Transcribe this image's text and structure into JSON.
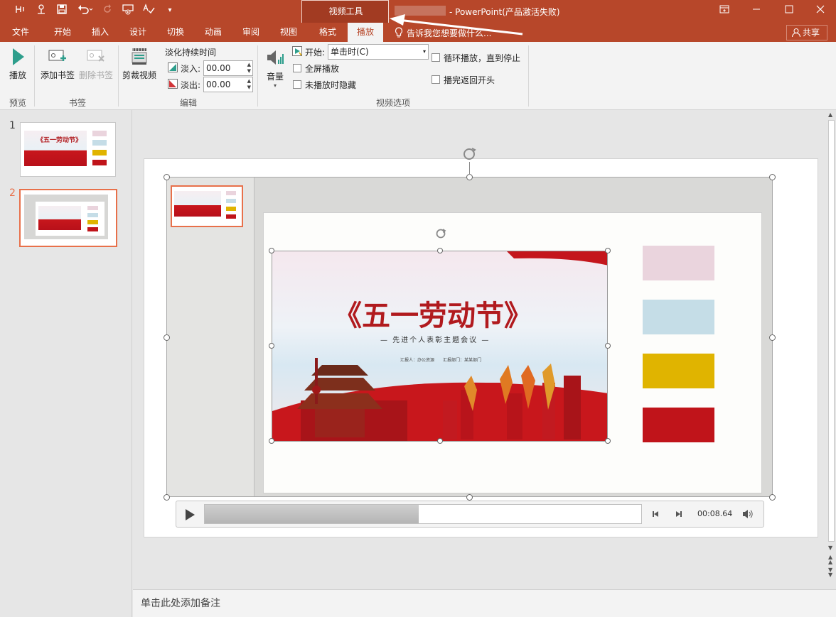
{
  "app": {
    "document_title": "- PowerPoint(产品激活失败)",
    "context_group": "视频工具",
    "share_label": "共享",
    "tell_me": "告诉我您想要做什么..."
  },
  "tabs": [
    "文件",
    "开始",
    "插入",
    "设计",
    "切换",
    "动画",
    "审阅",
    "视图"
  ],
  "context_tabs": [
    "格式",
    "播放"
  ],
  "ribbon": {
    "preview": {
      "play_label": "播放",
      "group": "预览"
    },
    "bookmarks": {
      "add_label": "添加书签",
      "delete_label": "删除书签",
      "group": "书签"
    },
    "editing": {
      "trim_label": "剪裁视频",
      "fade_title": "淡化持续时间",
      "fade_in_label": "淡入:",
      "fade_in_value": "00.00",
      "fade_out_label": "淡出:",
      "fade_out_value": "00.00",
      "group": "编辑"
    },
    "video_options": {
      "volume_label": "音量",
      "start_label": "开始:",
      "start_value": "单击时(C)",
      "fullscreen_label": "全屏播放",
      "hide_label": "未播放时隐藏",
      "loop_label": "循环播放，直到停止",
      "rewind_label": "播完返回开头",
      "group": "视频选项"
    }
  },
  "thumbnails": [
    {
      "number": "1"
    },
    {
      "number": "2"
    }
  ],
  "slide": {
    "title": "《五一劳动节》",
    "subtitle": "— 先进个人表彰主题会议 —",
    "reporter": "汇报人：办公资源",
    "department": "汇报部门：某某部门",
    "swatches": [
      "#ead4dd",
      "#c5dde7",
      "#e0b400",
      "#c0141a"
    ]
  },
  "player": {
    "time": "00:08.64",
    "progress": 0.49
  },
  "notes": {
    "placeholder": "单击此处添加备注"
  },
  "colors": {
    "accent": "#b7472a",
    "selected_thumb": "#e8704a"
  }
}
